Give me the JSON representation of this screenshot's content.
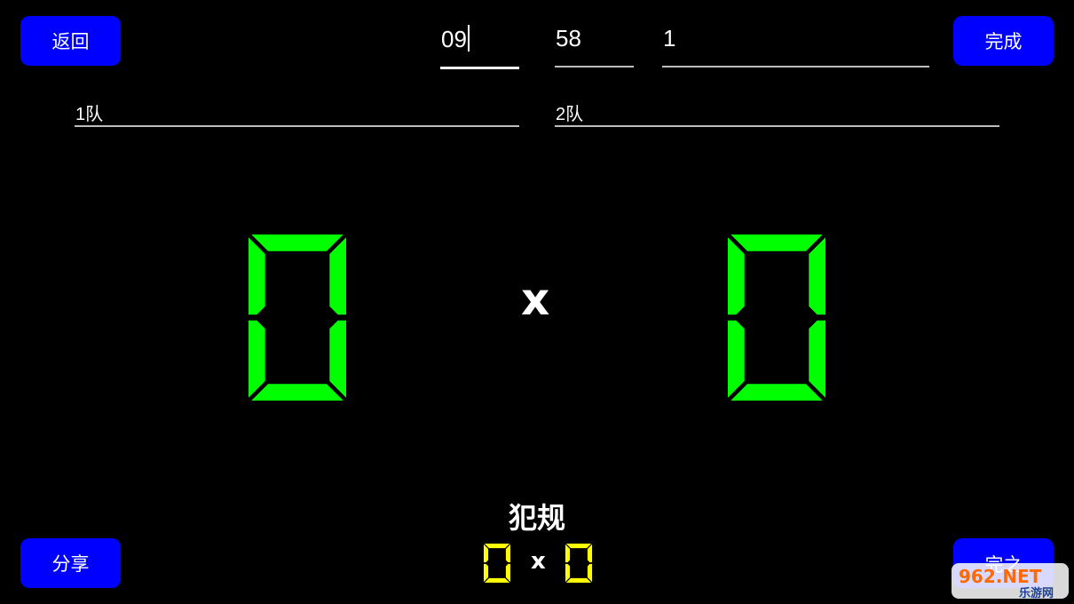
{
  "buttons": {
    "back": "返回",
    "done": "完成",
    "share": "分享",
    "bottom_right": "完之"
  },
  "timer": {
    "minutes": "09",
    "seconds": "58",
    "period": "1"
  },
  "teams": {
    "team1": "1队",
    "team2": "2队"
  },
  "score": {
    "team1": 0,
    "separator": "x",
    "team2": 0
  },
  "fouls": {
    "title": "犯规",
    "team1": 0,
    "separator": "x",
    "team2": 0
  },
  "watermark": {
    "line1": "962.NET",
    "line2": "乐游网"
  },
  "colors": {
    "background": "#000000",
    "button": "#0000ff",
    "score_digit": "#00ff00",
    "foul_digit": "#ffff00",
    "text": "#ffffff"
  }
}
